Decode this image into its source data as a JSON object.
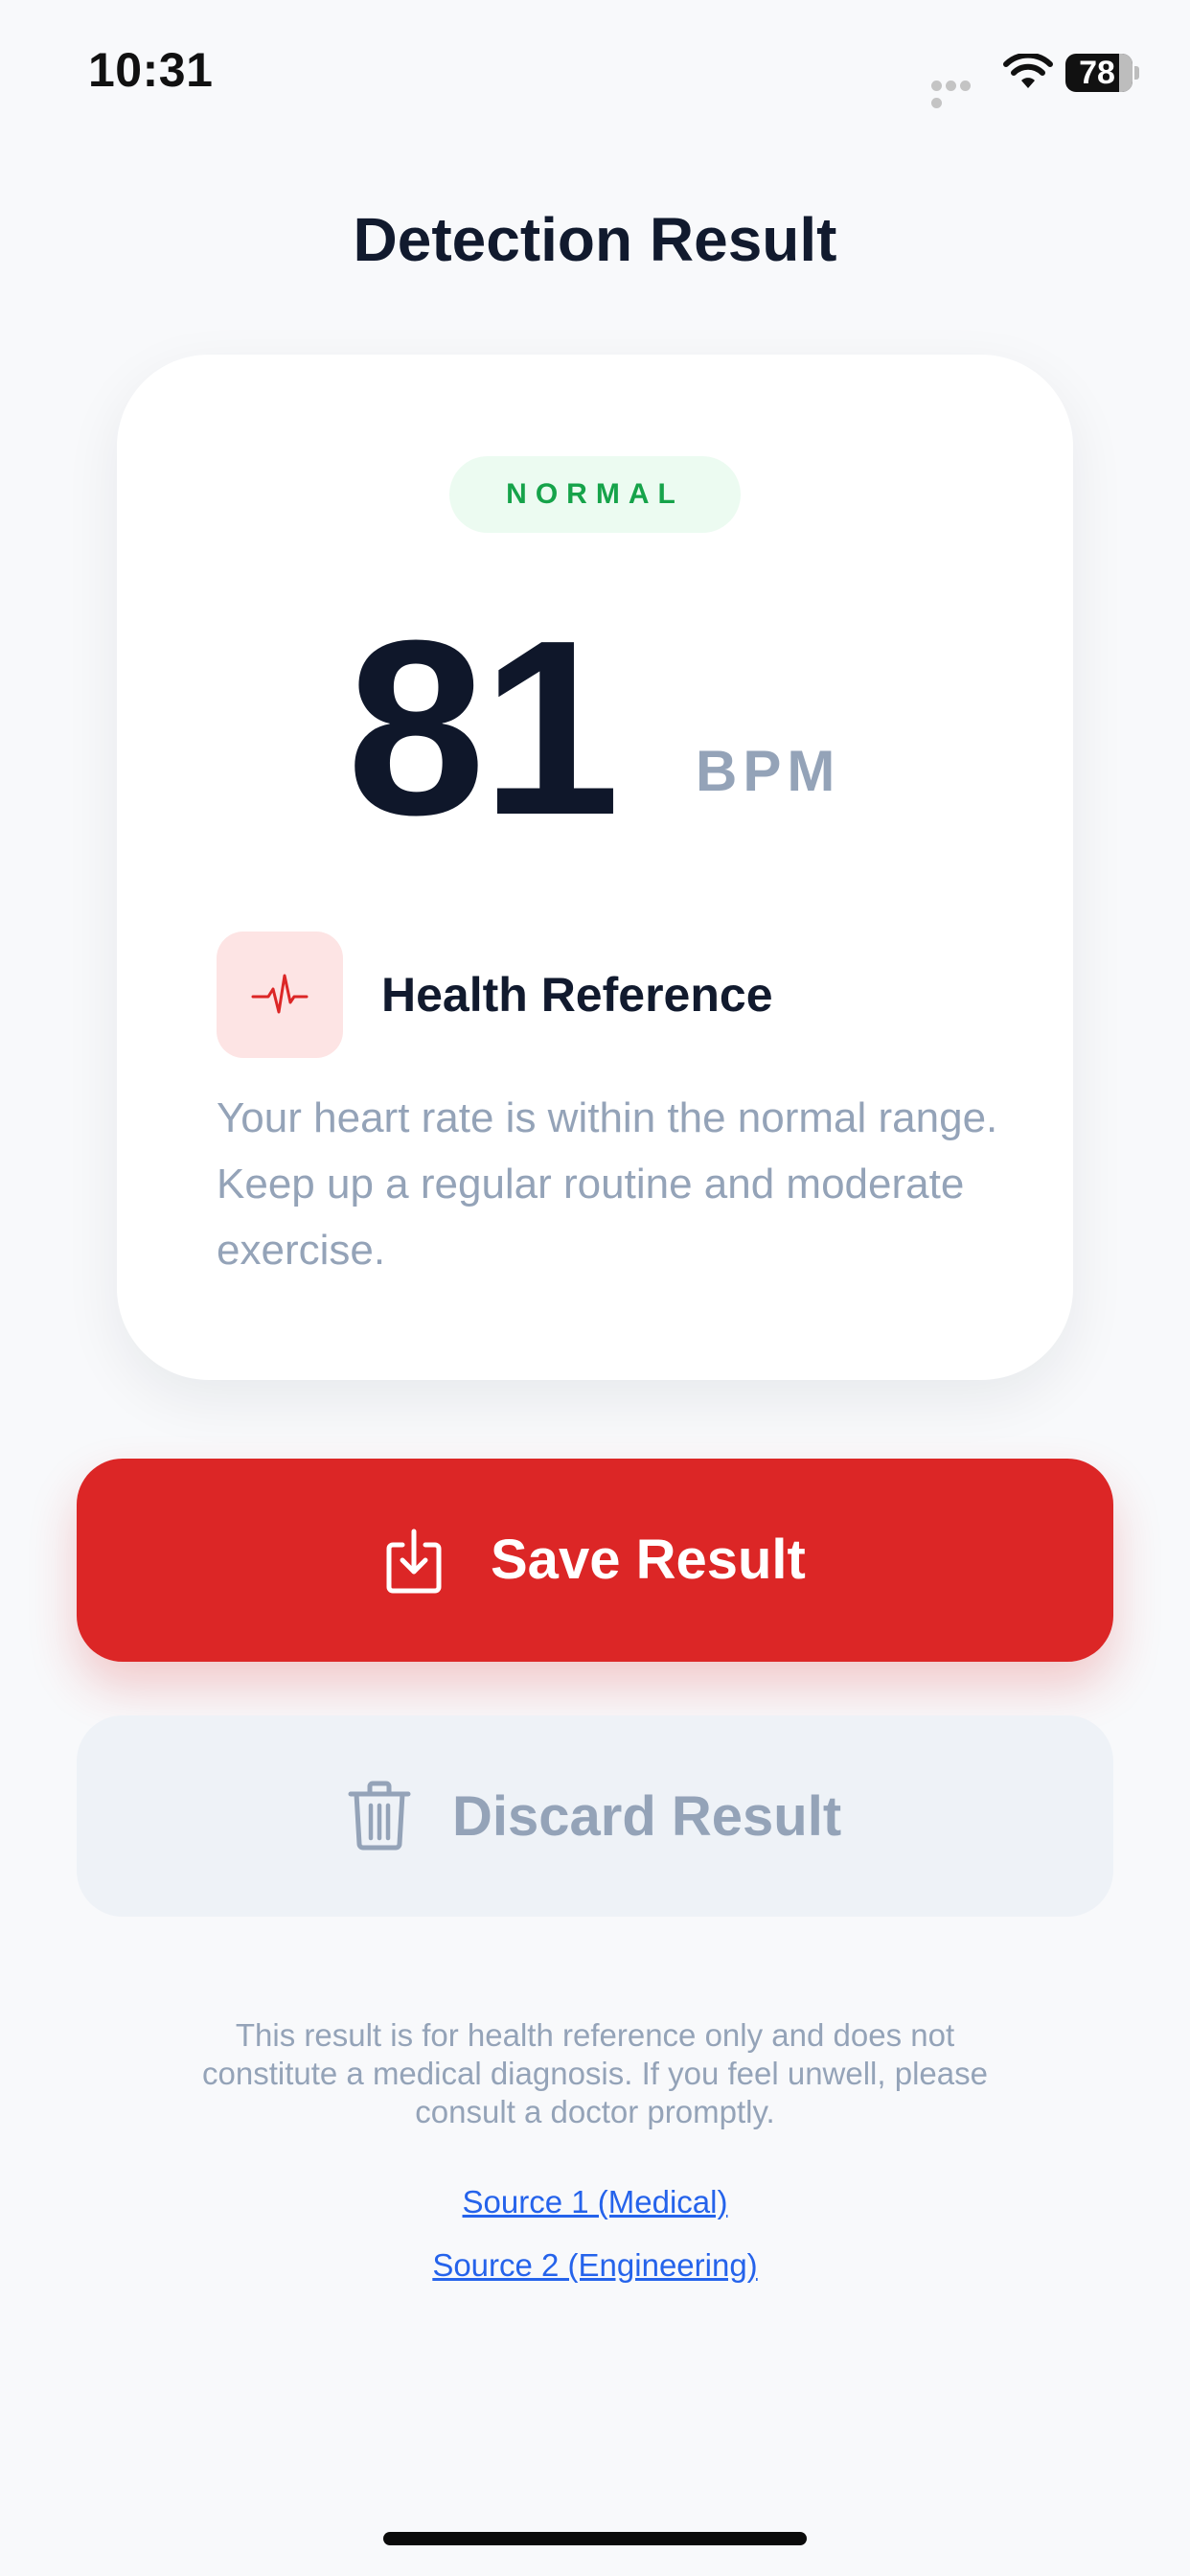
{
  "status_bar": {
    "time": "10:31",
    "battery_level": "78",
    "icons": [
      "signal-dots-icon",
      "wifi-icon",
      "battery-icon"
    ]
  },
  "page": {
    "title": "Detection Result"
  },
  "result": {
    "status": "NORMAL",
    "status_color": "#16a34a",
    "value": "81",
    "unit": "BPM",
    "reference_title": "Health Reference",
    "reference_icon": "heartbeat-icon",
    "reference_text": "Your heart rate is within the normal range. Keep up a regular routine and moderate exercise."
  },
  "actions": {
    "save_label": "Save Result",
    "save_icon": "download-icon",
    "save_color": "#dc2626",
    "discard_label": "Discard Result",
    "discard_icon": "trash-icon"
  },
  "footer": {
    "disclaimer": "This result is for health reference only and does not constitute a medical diagnosis. If you feel unwell, please consult a doctor promptly.",
    "sources": [
      {
        "label": "Source 1 (Medical)"
      },
      {
        "label": "Source 2 (Engineering)"
      }
    ]
  }
}
